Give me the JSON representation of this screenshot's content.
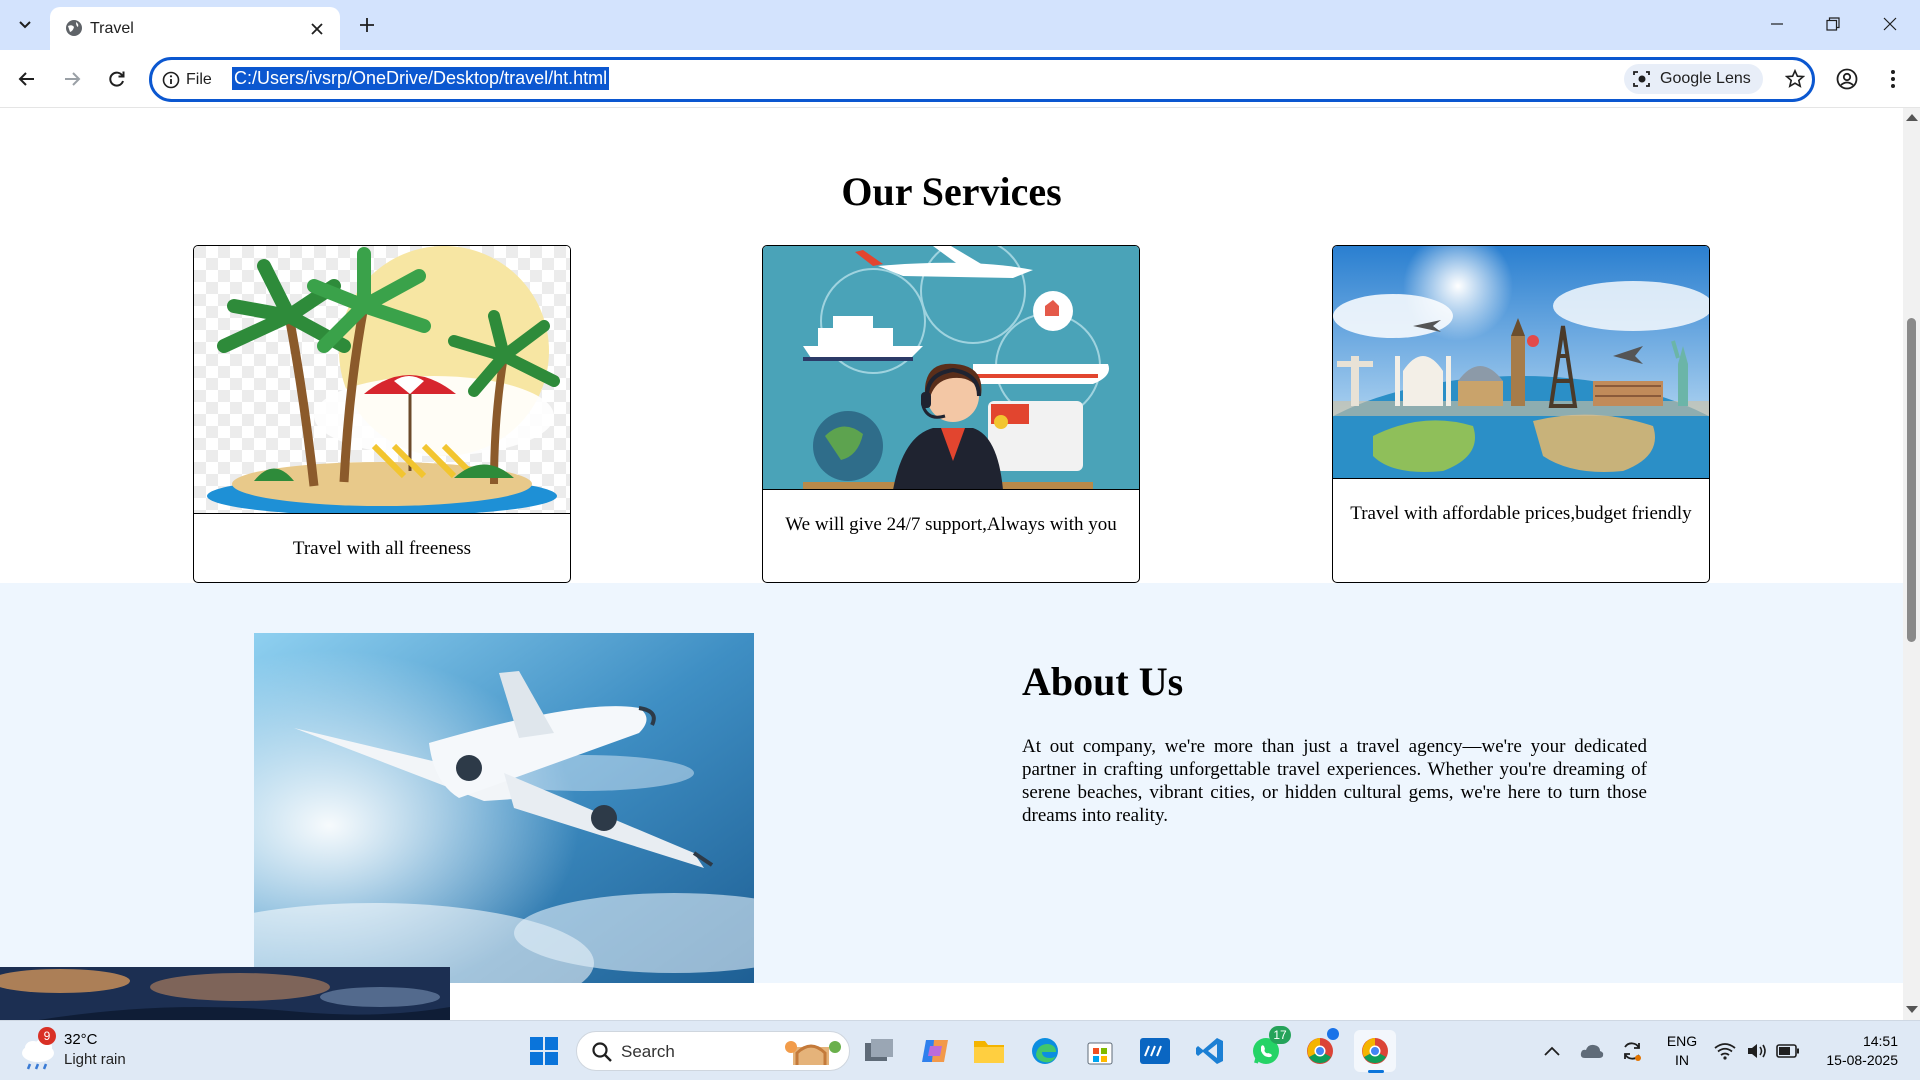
{
  "browser": {
    "tab_title": "Travel",
    "site_chip_label": "File",
    "url": "C:/Users/ivsrp/OneDrive/Desktop/travel/ht.html",
    "lens_label": "Google Lens"
  },
  "services": {
    "heading": "Our Services",
    "cards": [
      {
        "caption": "Travel with all freeness",
        "image": "tropical-island-illustration"
      },
      {
        "caption": "We will give 24/7 support,Always with you",
        "image": "travel-agent-support-illustration"
      },
      {
        "caption": "Travel with affordable prices,budget friendly",
        "image": "world-landmarks-globe"
      }
    ]
  },
  "about": {
    "heading": "About Us",
    "body": "At out company, we're more than just a travel agency—we're your dedicated partner in crafting unforgettable travel experiences. Whether you're dreaming of serene beaches, vibrant cities, or hidden cultural gems, we're here to turn those dreams into reality.",
    "image": "airplane-in-sky-photo"
  },
  "taskbar": {
    "weather_temp": "32°C",
    "weather_desc": "Light rain",
    "weather_badge": "9",
    "search_label": "Search",
    "whatsapp_badge": "17",
    "lang_line1": "ENG",
    "lang_line2": "IN",
    "time": "14:51",
    "date": "15-08-2025"
  },
  "colors": {
    "chrome_tabstrip": "#d3e3fd",
    "omnibox_focus": "#0b57d0",
    "about_background": "#eef6fe",
    "taskbar": "#dfe9f5"
  }
}
